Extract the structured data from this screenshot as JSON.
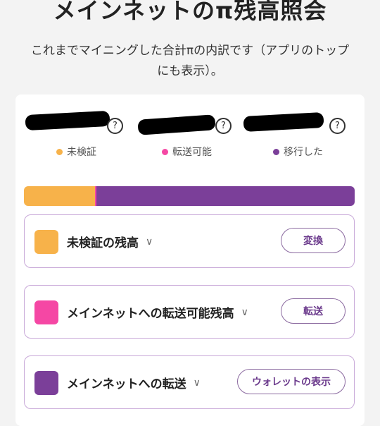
{
  "page": {
    "title": "メインネットのπ残高照会",
    "description": "これまでマイニングした合計πの内訳です（アプリのトップにも表示）。"
  },
  "balances": [
    {
      "legend": "未検証",
      "color": "#f7b24a"
    },
    {
      "legend": "転送可能",
      "color": "#f547a4"
    },
    {
      "legend": "移行した",
      "color": "#7b3f99"
    }
  ],
  "help_icon_glyph": "?",
  "progress": [
    {
      "color": "#f7b24a",
      "fraction": 0.215
    },
    {
      "color": "#f547a4",
      "fraction": 0.005
    },
    {
      "color": "#7b3f99",
      "fraction": 0.78
    }
  ],
  "rows": [
    {
      "label": "未検証の残高",
      "button": "変換",
      "color": "#f7b24a",
      "chevron": "∨"
    },
    {
      "label": "メインネットへの転送可能残高",
      "button": "転送",
      "color": "#f547a4",
      "chevron": "∨"
    },
    {
      "label": "メインネットへの転送",
      "button": "ウォレットの表示",
      "color": "#7b3f99",
      "chevron": "∨"
    }
  ]
}
